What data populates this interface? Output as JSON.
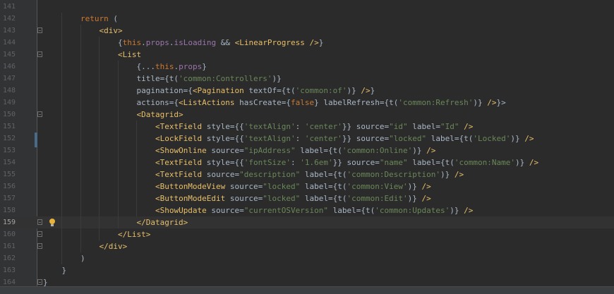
{
  "editor": {
    "lines": [
      {
        "num": "141",
        "tokens": []
      },
      {
        "num": "142",
        "tokens": [
          {
            "t": "        "
          },
          {
            "t": "return",
            "c": "kw"
          },
          {
            "t": " ("
          }
        ]
      },
      {
        "num": "143",
        "tokens": [
          {
            "t": "            "
          },
          {
            "t": "<div>",
            "c": "tag"
          }
        ]
      },
      {
        "num": "144",
        "tokens": [
          {
            "t": "                {"
          },
          {
            "t": "this",
            "c": "this"
          },
          {
            "t": "."
          },
          {
            "t": "props",
            "c": "prop"
          },
          {
            "t": "."
          },
          {
            "t": "isLoading",
            "c": "prop"
          },
          {
            "t": " && "
          },
          {
            "t": "<LinearProgress />",
            "c": "tag"
          },
          {
            "t": "}"
          }
        ]
      },
      {
        "num": "145",
        "tokens": [
          {
            "t": "                "
          },
          {
            "t": "<List",
            "c": "tag"
          }
        ]
      },
      {
        "num": "146",
        "tokens": [
          {
            "t": "                    {..."
          },
          {
            "t": "this",
            "c": "this"
          },
          {
            "t": "."
          },
          {
            "t": "props",
            "c": "prop"
          },
          {
            "t": "}"
          }
        ]
      },
      {
        "num": "147",
        "tokens": [
          {
            "t": "                    title={t("
          },
          {
            "t": "'common:Controllers'",
            "c": "str"
          },
          {
            "t": ")}"
          }
        ]
      },
      {
        "num": "148",
        "tokens": [
          {
            "t": "                    pagination={"
          },
          {
            "t": "<Pagination",
            "c": "tag"
          },
          {
            "t": " textOf={t("
          },
          {
            "t": "'common:of'",
            "c": "str"
          },
          {
            "t": ")} "
          },
          {
            "t": "/>",
            "c": "tag"
          },
          {
            "t": "}"
          }
        ]
      },
      {
        "num": "149",
        "tokens": [
          {
            "t": "                    actions={"
          },
          {
            "t": "<ListActions",
            "c": "tag"
          },
          {
            "t": " hasCreate={"
          },
          {
            "t": "false",
            "c": "kw"
          },
          {
            "t": "} labelRefresh={t("
          },
          {
            "t": "'common:Refresh'",
            "c": "str"
          },
          {
            "t": ")} "
          },
          {
            "t": "/>",
            "c": "tag"
          },
          {
            "t": "}>"
          }
        ]
      },
      {
        "num": "150",
        "tokens": [
          {
            "t": "                    "
          },
          {
            "t": "<Datagrid>",
            "c": "tag"
          }
        ]
      },
      {
        "num": "151",
        "tokens": [
          {
            "t": "                        "
          },
          {
            "t": "<TextField",
            "c": "tag"
          },
          {
            "t": " style={{"
          },
          {
            "t": "'textAlign'",
            "c": "str"
          },
          {
            "t": ": "
          },
          {
            "t": "'center'",
            "c": "str"
          },
          {
            "t": "}} source="
          },
          {
            "t": "\"id\"",
            "c": "str"
          },
          {
            "t": " label="
          },
          {
            "t": "\"Id\"",
            "c": "str"
          },
          {
            "t": " "
          },
          {
            "t": "/>",
            "c": "tag"
          }
        ]
      },
      {
        "num": "152",
        "tokens": [
          {
            "t": "                        "
          },
          {
            "t": "<LockField",
            "c": "tag"
          },
          {
            "t": " style={{"
          },
          {
            "t": "'textAlign'",
            "c": "str"
          },
          {
            "t": ": "
          },
          {
            "t": "'center'",
            "c": "str"
          },
          {
            "t": "}} source="
          },
          {
            "t": "\"locked\"",
            "c": "str"
          },
          {
            "t": " label={t("
          },
          {
            "t": "'Locked'",
            "c": "str"
          },
          {
            "t": ")} "
          },
          {
            "t": "/>",
            "c": "tag"
          }
        ]
      },
      {
        "num": "153",
        "tokens": [
          {
            "t": "                        "
          },
          {
            "t": "<ShowOnline",
            "c": "tag"
          },
          {
            "t": " source="
          },
          {
            "t": "\"ipAddress\"",
            "c": "str"
          },
          {
            "t": " label={t("
          },
          {
            "t": "'common:Online'",
            "c": "str"
          },
          {
            "t": ")} "
          },
          {
            "t": "/>",
            "c": "tag"
          }
        ]
      },
      {
        "num": "154",
        "tokens": [
          {
            "t": "                        "
          },
          {
            "t": "<TextField",
            "c": "tag"
          },
          {
            "t": " style={{"
          },
          {
            "t": "'fontSize'",
            "c": "str"
          },
          {
            "t": ": "
          },
          {
            "t": "'1.6em'",
            "c": "str"
          },
          {
            "t": "}} source="
          },
          {
            "t": "\"name\"",
            "c": "str"
          },
          {
            "t": " label={t("
          },
          {
            "t": "'common:Name'",
            "c": "str"
          },
          {
            "t": ")} "
          },
          {
            "t": "/>",
            "c": "tag"
          }
        ]
      },
      {
        "num": "155",
        "tokens": [
          {
            "t": "                        "
          },
          {
            "t": "<TextField",
            "c": "tag"
          },
          {
            "t": " source="
          },
          {
            "t": "\"description\"",
            "c": "str"
          },
          {
            "t": " label={t("
          },
          {
            "t": "'common:Description'",
            "c": "str"
          },
          {
            "t": ")} "
          },
          {
            "t": "/>",
            "c": "tag"
          }
        ]
      },
      {
        "num": "156",
        "tokens": [
          {
            "t": "                        "
          },
          {
            "t": "<ButtonModeView",
            "c": "tag"
          },
          {
            "t": " source="
          },
          {
            "t": "\"locked\"",
            "c": "str"
          },
          {
            "t": " label={t("
          },
          {
            "t": "'common:View'",
            "c": "str"
          },
          {
            "t": ")} "
          },
          {
            "t": "/>",
            "c": "tag"
          }
        ]
      },
      {
        "num": "157",
        "tokens": [
          {
            "t": "                        "
          },
          {
            "t": "<ButtonModeEdit",
            "c": "tag"
          },
          {
            "t": " source="
          },
          {
            "t": "\"locked\"",
            "c": "str"
          },
          {
            "t": " label={t("
          },
          {
            "t": "'common:Edit'",
            "c": "str"
          },
          {
            "t": ")} "
          },
          {
            "t": "/>",
            "c": "tag"
          }
        ]
      },
      {
        "num": "158",
        "tokens": [
          {
            "t": "                        "
          },
          {
            "t": "<ShowUpdate",
            "c": "tag"
          },
          {
            "t": " source="
          },
          {
            "t": "\"currentOSVersion\"",
            "c": "str"
          },
          {
            "t": " label={t("
          },
          {
            "t": "'common:Updates'",
            "c": "str"
          },
          {
            "t": ")} "
          },
          {
            "t": "/>",
            "c": "tag"
          }
        ]
      },
      {
        "num": "159",
        "tokens": [
          {
            "t": "                    "
          },
          {
            "t": "</Datagrid>",
            "c": "tag"
          }
        ]
      },
      {
        "num": "160",
        "tokens": [
          {
            "t": "                "
          },
          {
            "t": "</List>",
            "c": "tag"
          }
        ]
      },
      {
        "num": "161",
        "tokens": [
          {
            "t": "            "
          },
          {
            "t": "</div>",
            "c": "tag"
          }
        ]
      },
      {
        "num": "162",
        "tokens": [
          {
            "t": "        )"
          }
        ]
      },
      {
        "num": "163",
        "tokens": [
          {
            "t": "    }"
          }
        ]
      },
      {
        "num": "164",
        "tokens": [
          {
            "t": "}"
          }
        ]
      }
    ],
    "current_line": "159",
    "colors": {
      "background": "#2b2b2b",
      "gutter": "#313335",
      "keyword": "#cc7832",
      "tag": "#e8bf6a",
      "string": "#6a8759",
      "plain": "#a9b7c6",
      "property": "#9876aa",
      "line_number": "#606366"
    },
    "icons": {
      "intention": "lightbulb-icon",
      "fold": "fold-marker-icon"
    }
  }
}
